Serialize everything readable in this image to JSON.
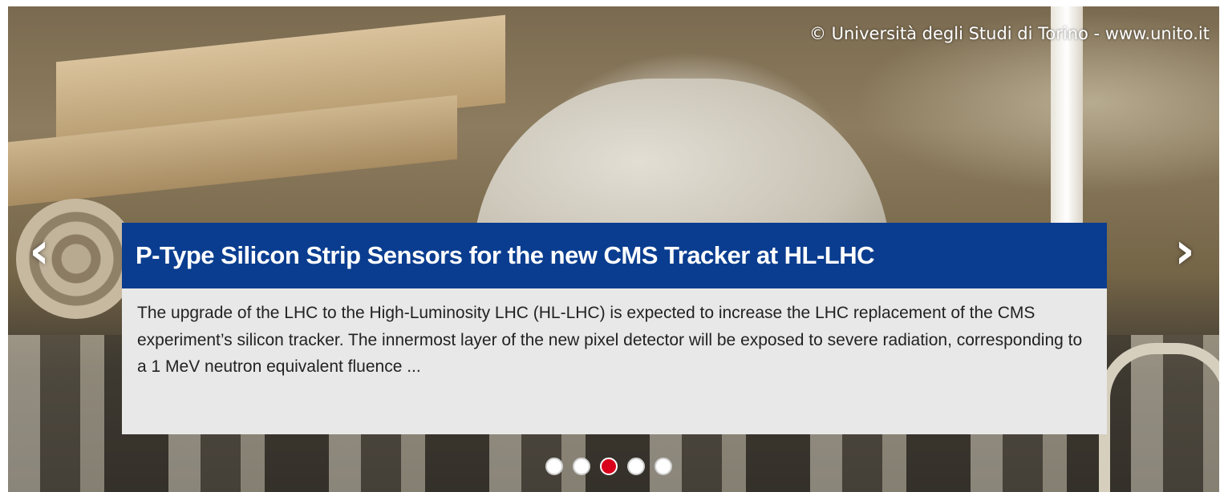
{
  "credit": "© Università degli Studi di Torino - www.unito.it",
  "nav": {
    "prev_glyph": "‹",
    "next_glyph": "›"
  },
  "slide": {
    "title": "P-Type Silicon Strip Sensors for the new CMS Tracker at HL-LHC",
    "body": "The upgrade of the LHC to the High-Luminosity LHC (HL-LHC) is expected to increase the LHC replacement of the CMS experiment’s silicon tracker. The innermost layer of the new pixel detector will be exposed to severe radiation, corresponding to a 1 MeV neutron equivalent fluence ..."
  },
  "pagination": {
    "count": 5,
    "active_index": 2
  },
  "colors": {
    "title_bg": "#0a3d8f",
    "body_bg": "#e8e8e8",
    "active_dot": "#d9001b"
  }
}
